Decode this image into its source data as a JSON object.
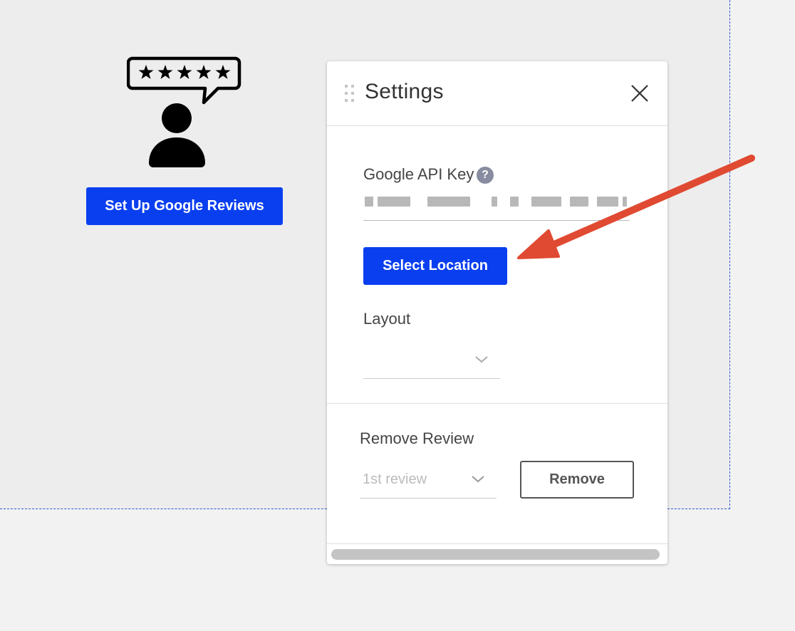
{
  "canvas": {
    "setup_button_label": "Set Up Google Reviews",
    "widget_icon": "review-person-icon"
  },
  "settings_panel": {
    "title": "Settings",
    "api_key": {
      "label": "Google API Key",
      "help_icon": "?"
    },
    "select_location_label": "Select Location",
    "layout": {
      "label": "Layout",
      "value": ""
    },
    "remove_review": {
      "label": "Remove Review",
      "select_value": "1st review",
      "button_label": "Remove"
    }
  },
  "colors": {
    "primary": "#0a3ff0",
    "annotation_arrow": "#e04a32",
    "dashed_border": "#2f56d8"
  }
}
